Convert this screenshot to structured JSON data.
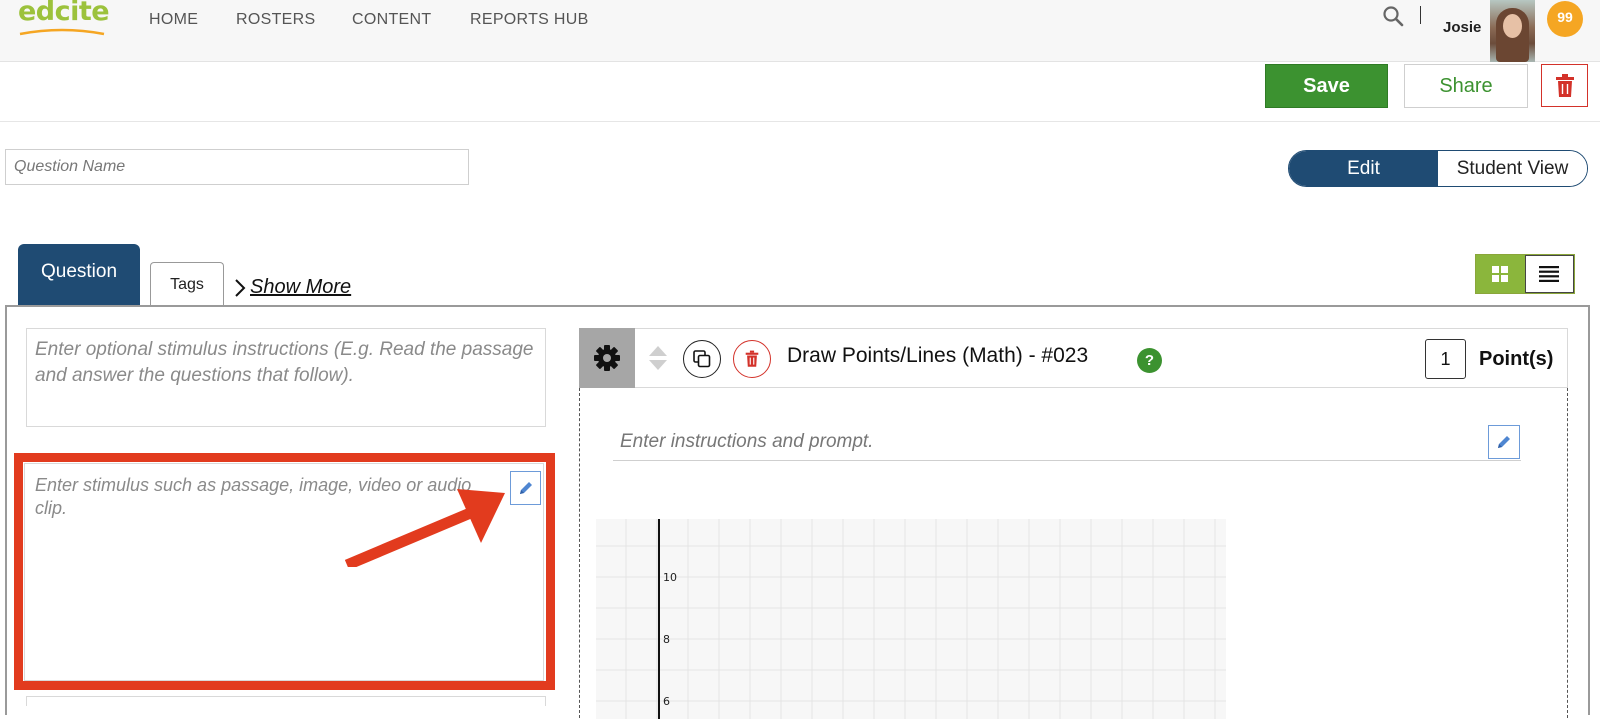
{
  "nav": {
    "logo": "edcite",
    "items": [
      "HOME",
      "ROSTERS",
      "CONTENT",
      "REPORTS HUB"
    ],
    "user_name": "Josie",
    "notification_count": "99"
  },
  "actions": {
    "save_label": "Save",
    "share_label": "Share"
  },
  "question_name": {
    "value": "",
    "placeholder": "Question Name"
  },
  "view_toggle": {
    "edit_label": "Edit",
    "student_label": "Student View",
    "selected": "Edit"
  },
  "tabs": {
    "question_label": "Question",
    "tags_label": "Tags",
    "show_more_label": "Show More"
  },
  "stimulus": {
    "instructions_placeholder": "Enter optional stimulus instructions (E.g. Read the passage and answer the questions that follow).",
    "editor_placeholder": "Enter stimulus such as passage, image, video or audio clip."
  },
  "question": {
    "title": "Draw Points/Lines (Math) - #023",
    "help": "?",
    "points_value": "1",
    "points_label": "Point(s)",
    "prompt_placeholder": "Enter instructions and prompt."
  },
  "graph": {
    "y_labels": [
      "10",
      "8",
      "6"
    ]
  },
  "colors": {
    "brand_green": "#3c9230",
    "navy": "#1f4b73",
    "highlight_red": "#e23b1e",
    "badge_orange": "#f5a623"
  }
}
